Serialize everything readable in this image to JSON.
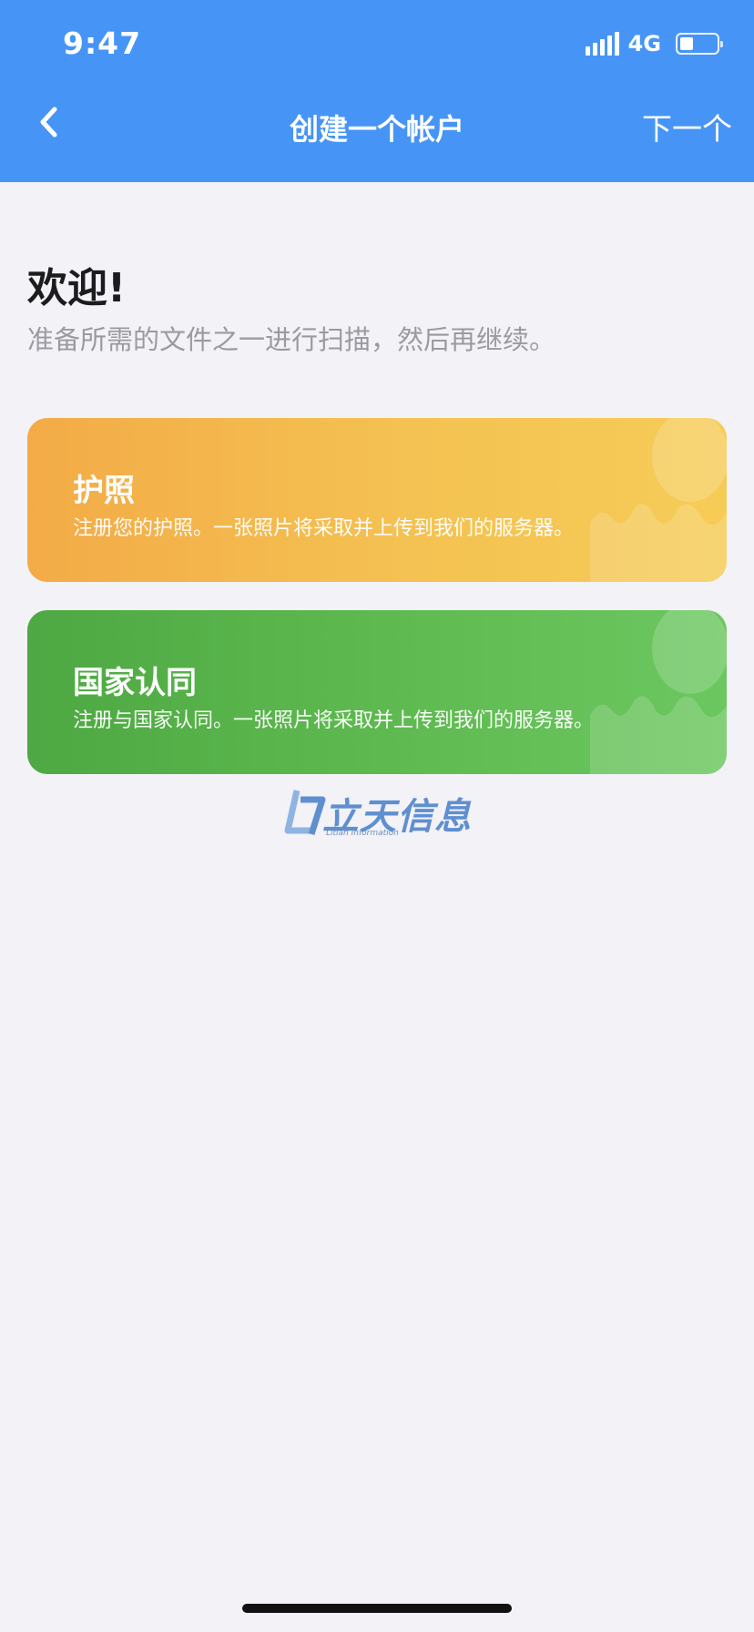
{
  "status_bar": {
    "time": "9:47",
    "network": "4G",
    "battery_level": 0.25
  },
  "nav": {
    "back_icon": "chevron-left-icon",
    "title": "创建一个帐户",
    "next_label": "下一个"
  },
  "welcome": {
    "title": "欢迎!",
    "subtitle": "准备所需的文件之一进行扫描，然后再继续。"
  },
  "documents": [
    {
      "title": "护照",
      "description": "注册您的护照。一张照片将采取并上传到我们的服务器。",
      "color": "#f4b64c"
    },
    {
      "title": "国家认同",
      "description": "注册与国家认同。一张照片将采取并上传到我们的服务器。",
      "color": "#5ab54c"
    }
  ],
  "watermark": {
    "text": "立天信息",
    "subtext": "Litian Information"
  },
  "colors": {
    "header": "#4695f6",
    "background": "#f2f2f7"
  }
}
